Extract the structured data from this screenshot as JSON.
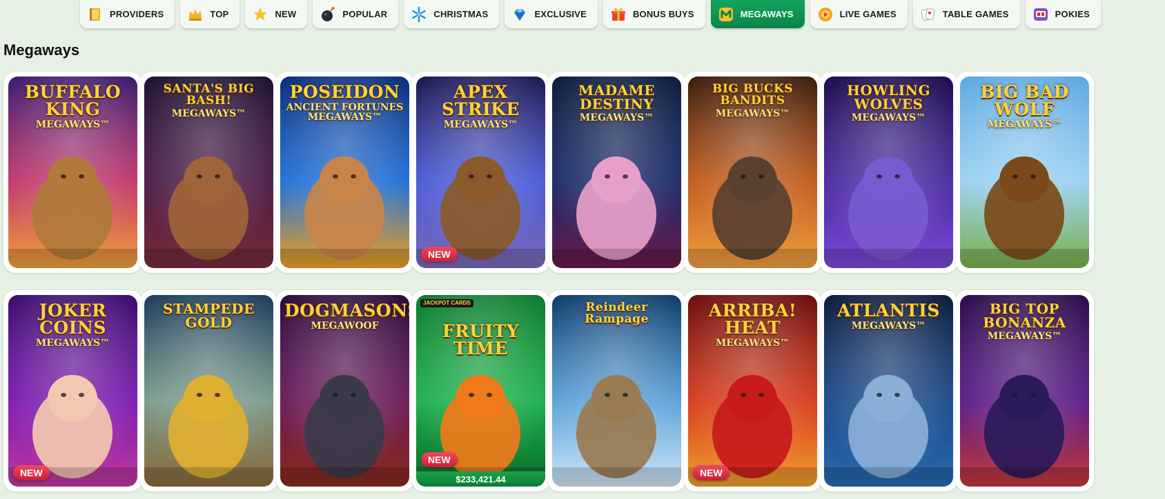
{
  "nav": {
    "tabs": [
      {
        "label": "PROVIDERS",
        "icon": "book-icon",
        "active": false
      },
      {
        "label": "TOP",
        "icon": "crown-icon",
        "active": false
      },
      {
        "label": "NEW",
        "icon": "star-icon",
        "active": false
      },
      {
        "label": "POPULAR",
        "icon": "bomb-icon",
        "active": false
      },
      {
        "label": "CHRISTMAS",
        "icon": "snowflake-icon",
        "active": false
      },
      {
        "label": "EXCLUSIVE",
        "icon": "gem-icon",
        "active": false
      },
      {
        "label": "BONUS BUYS",
        "icon": "gift-icon",
        "active": false
      },
      {
        "label": "MEGAWAYS",
        "icon": "m-icon",
        "active": true
      },
      {
        "label": "LIVE GAMES",
        "icon": "live-icon",
        "active": false
      },
      {
        "label": "TABLE GAMES",
        "icon": "cards-icon",
        "active": false
      },
      {
        "label": "POKIES",
        "icon": "slot-machine-icon",
        "active": false
      }
    ]
  },
  "section": {
    "title": "Megaways"
  },
  "games": [
    {
      "title": "BUFFALO KING",
      "subtitle": "MEGAWAYS™",
      "colors": [
        "#3a1a6e",
        "#c2366b",
        "#f0a13a"
      ],
      "creature": "#b07a3a",
      "is_new": false
    },
    {
      "title": "SANTA'S BIG BASH!",
      "subtitle": "MEGAWAYS™",
      "colors": [
        "#1a1030",
        "#4a1b45",
        "#7a2c3a"
      ],
      "creature": "#a0643a",
      "is_new": false
    },
    {
      "title": "POSEIDON",
      "subtitle": "ANCIENT FORTUNES MEGAWAYS™",
      "colors": [
        "#0a2c7a",
        "#1e6fd8",
        "#f0a020"
      ],
      "creature": "#c9844a",
      "is_new": false
    },
    {
      "title": "APEX STRIKE",
      "subtitle": "MEGAWAYS™",
      "colors": [
        "#1a1650",
        "#4a5ad8",
        "#7a6ab8"
      ],
      "creature": "#8a5a2a",
      "is_new": true
    },
    {
      "title": "MADAME DESTINY",
      "subtitle": "MEGAWAYS™",
      "colors": [
        "#0a1a3a",
        "#1a2a6a",
        "#6a1a4a"
      ],
      "creature": "#e6a0c8",
      "is_new": false
    },
    {
      "title": "BIG BUCKS BANDITS",
      "subtitle": "MEGAWAYS™",
      "colors": [
        "#3a1a0a",
        "#c25a1a",
        "#f0a040"
      ],
      "creature": "#5a4030",
      "is_new": false
    },
    {
      "title": "HOWLING WOLVES",
      "subtitle": "MEGAWAYS™",
      "colors": [
        "#1a0a4a",
        "#4a2aa0",
        "#7a4ad8"
      ],
      "creature": "#7a5ad0",
      "is_new": false
    },
    {
      "title": "BIG BAD WOLF",
      "subtitle": "MEGAWAYS™",
      "colors": [
        "#5aa8e0",
        "#9ad0f0",
        "#7ab04a"
      ],
      "creature": "#7a4a1a",
      "is_new": false
    },
    {
      "title": "JOKER COINS",
      "subtitle": "MEGAWAYS™",
      "colors": [
        "#3a0a6a",
        "#7a1ab0",
        "#c23aa0"
      ],
      "creature": "#f2c8b0",
      "is_new": true
    },
    {
      "title": "STAMPEDE GOLD",
      "subtitle": "",
      "colors": [
        "#1a3a5a",
        "#7a9a8a",
        "#8a6a3a"
      ],
      "creature": "#e0b030",
      "is_new": false
    },
    {
      "title": "DOGMASONS",
      "subtitle": "MEGAWOOF",
      "colors": [
        "#2a0a3a",
        "#6a1a5a",
        "#8a2a1a"
      ],
      "creature": "#3a3a4a",
      "is_new": false
    },
    {
      "title": "FRUITY TIME",
      "subtitle": "",
      "colors": [
        "#0a7a2a",
        "#1ab04a",
        "#0a6a2a"
      ],
      "creature": "#f07a1a",
      "is_new": true,
      "jackpot_tag": "JACKPOT CARDS",
      "jackpot": "$233,421.44"
    },
    {
      "title": "Reindeer Rampage",
      "subtitle": "",
      "colors": [
        "#0a3a6a",
        "#5aa0d8",
        "#d0e8f8"
      ],
      "creature": "#9a7a50",
      "is_new": false
    },
    {
      "title": "ARRIBA! HEAT",
      "subtitle": "MEGAWAYS™",
      "colors": [
        "#6a0a0a",
        "#d83a1a",
        "#f0a030"
      ],
      "creature": "#c81a1a",
      "is_new": true
    },
    {
      "title": "ATLANTIS",
      "subtitle": "MEGAWAYS™",
      "colors": [
        "#0a1a3a",
        "#1a4a8a",
        "#2a6ab0"
      ],
      "creature": "#8ab0d8",
      "is_new": false
    },
    {
      "title": "BIG TOP BONANZA",
      "subtitle": "MEGAWAYS™",
      "colors": [
        "#2a0a4a",
        "#5a1a8a",
        "#c23a3a"
      ],
      "creature": "#2a1a5a",
      "is_new": false
    }
  ],
  "labels": {
    "new_badge": "NEW"
  }
}
